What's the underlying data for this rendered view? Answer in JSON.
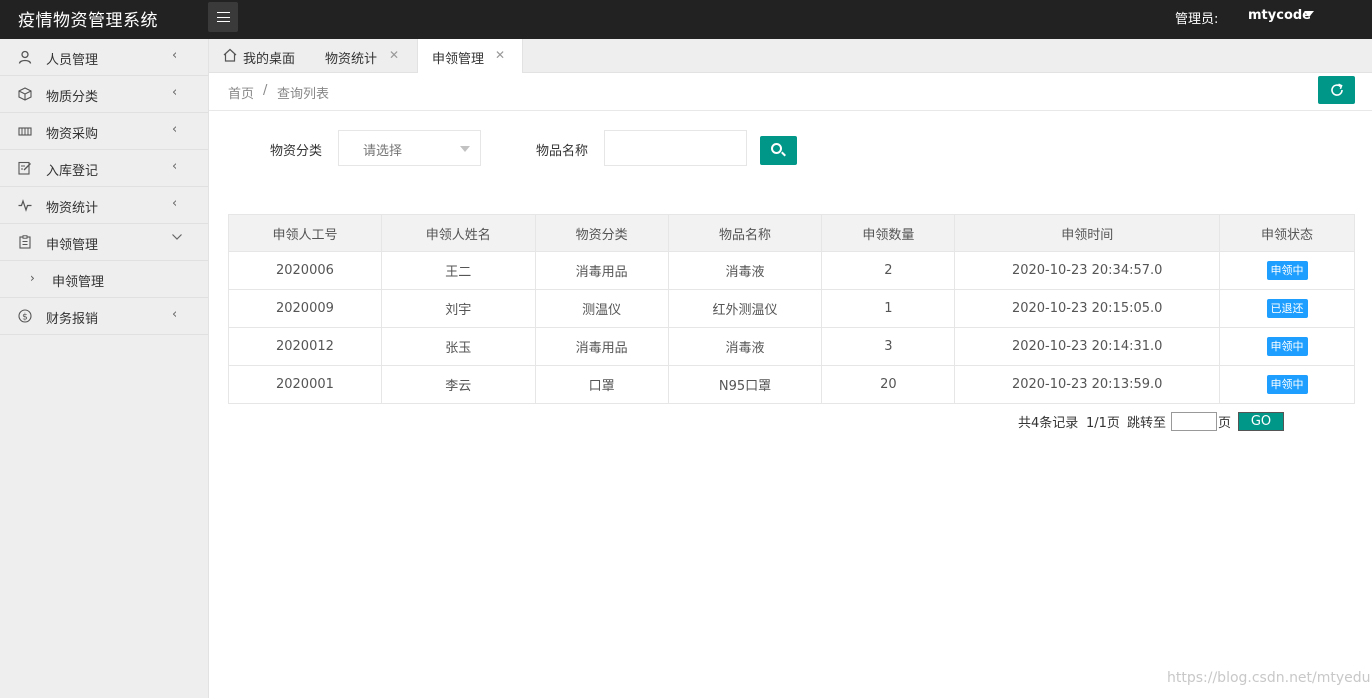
{
  "header": {
    "app_title": "疫情物资管理系统",
    "admin_label": "管理员:",
    "admin_user": "mtycode"
  },
  "sidebar": {
    "items": [
      {
        "label": "人员管理",
        "icon": "user-icon"
      },
      {
        "label": "物质分类",
        "icon": "cube-icon"
      },
      {
        "label": "物资采购",
        "icon": "cart-icon"
      },
      {
        "label": "入库登记",
        "icon": "edit-icon"
      },
      {
        "label": "物资统计",
        "icon": "pulse-icon"
      },
      {
        "label": "申领管理",
        "icon": "clipboard-icon"
      },
      {
        "label": "财务报销",
        "icon": "dollar-icon"
      }
    ],
    "sub_item": "申领管理"
  },
  "tabs": [
    {
      "label": "我的桌面"
    },
    {
      "label": "物资统计"
    },
    {
      "label": "申领管理"
    }
  ],
  "breadcrumb": {
    "home": "首页",
    "separator": "/",
    "current": "查询列表"
  },
  "filters": {
    "category_label": "物资分类",
    "category_placeholder": "请选择",
    "name_label": "物品名称",
    "name_value": ""
  },
  "table": {
    "columns": [
      "申领人工号",
      "申领人姓名",
      "物资分类",
      "物品名称",
      "申领数量",
      "申领时间",
      "申领状态"
    ],
    "rows": [
      [
        "2020006",
        "王二",
        "消毒用品",
        "消毒液",
        "2",
        "2020-10-23 20:34:57.0",
        "申领中"
      ],
      [
        "2020009",
        "刘宇",
        "测温仪",
        "红外测温仪",
        "1",
        "2020-10-23 20:15:05.0",
        "已退还"
      ],
      [
        "2020012",
        "张玉",
        "消毒用品",
        "消毒液",
        "3",
        "2020-10-23 20:14:31.0",
        "申领中"
      ],
      [
        "2020001",
        "李云",
        "口罩",
        "N95口罩",
        "20",
        "2020-10-23 20:13:59.0",
        "申领中"
      ]
    ]
  },
  "pagination": {
    "total": "共4条记录",
    "pages": "1/1页",
    "jump_label": "跳转至",
    "page_unit": "页",
    "go_label": "GO"
  },
  "watermark": "https://blog.csdn.net/mtyedu",
  "colors": {
    "header_bg": "#222222",
    "accent": "#009688",
    "status_badge": "#1e9fff"
  }
}
